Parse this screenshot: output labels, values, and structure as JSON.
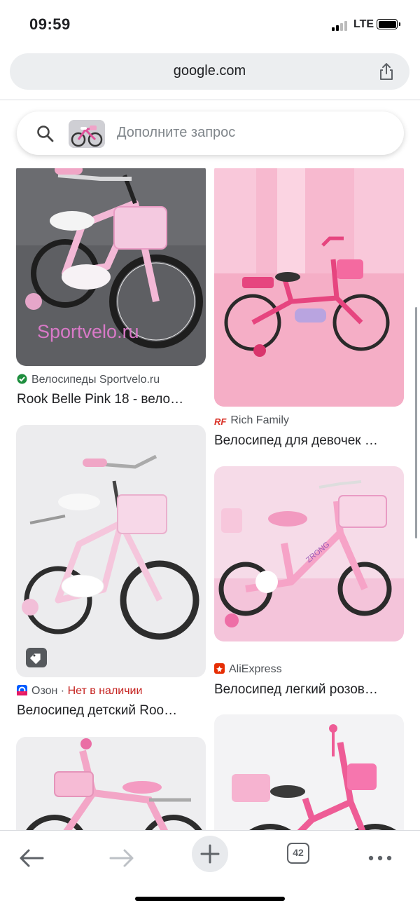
{
  "status_bar": {
    "time": "09:59",
    "network": "LTE"
  },
  "browser": {
    "url": "google.com"
  },
  "search": {
    "placeholder": "Дополните запрос"
  },
  "results": [
    {
      "source": "Велосипеды Sportvelo.ru",
      "title": "Rook Belle Pink 18 - вело…",
      "watermark": "Sportvelo.ru"
    },
    {
      "source": "Rich Family",
      "title": "Велосипед для девочек …"
    },
    {
      "source": "Озон",
      "stock": "Нет в наличии",
      "separator": " · ",
      "title": "Велосипед детский Roo…"
    },
    {
      "source": "AliExpress",
      "title": "Велосипед легкий розов…"
    }
  ],
  "toolbar": {
    "tab_count": "42"
  },
  "colors": {
    "accent": "#1a73e8",
    "stock_red": "#c5221f",
    "pink": "#f4a7c4"
  }
}
